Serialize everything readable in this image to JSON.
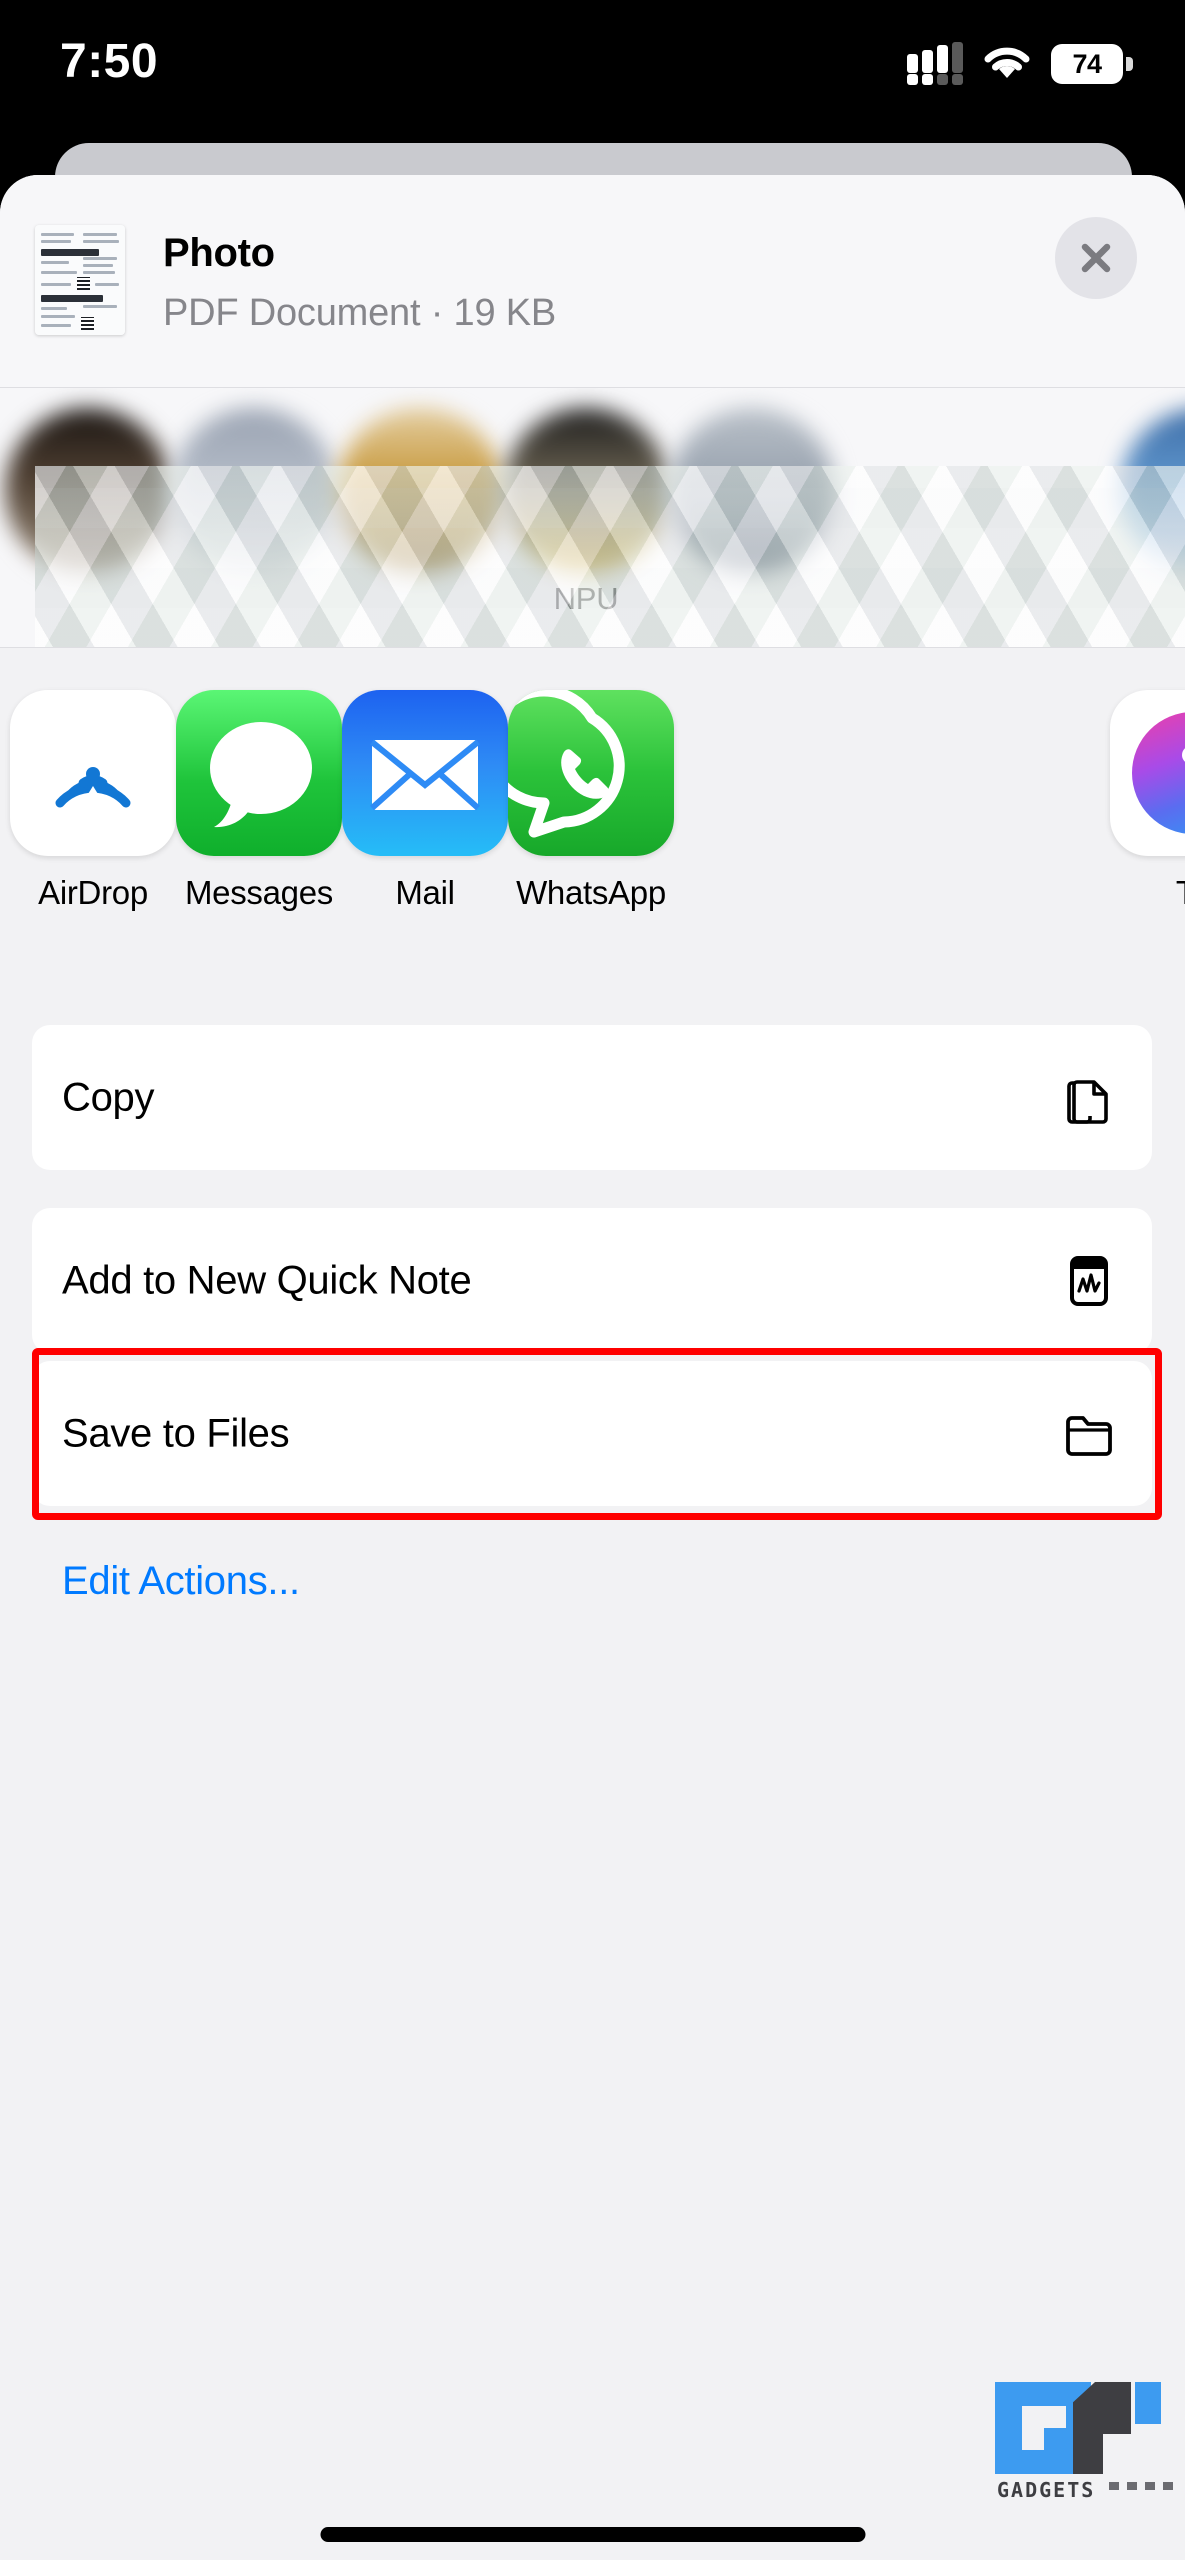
{
  "status_bar": {
    "time": "7:50",
    "signal_icon": "cellular-signal-icon",
    "wifi_icon": "wifi-icon",
    "battery_level": "74"
  },
  "share_sheet": {
    "document": {
      "title": "Photo",
      "subtitle": "PDF Document · 19 KB",
      "thumbnail_icon": "document-thumbnail"
    },
    "close_label": "Close",
    "close_icon": "close-icon",
    "contacts": [
      {
        "name": "",
        "avatar_color": "#3a2f28"
      },
      {
        "name": "",
        "avatar_color": "#9aa3b2"
      },
      {
        "name": "",
        "avatar_color": "#c9a24a"
      },
      {
        "name": "NPU",
        "avatar_color": "#2f2f2f"
      },
      {
        "name": "",
        "avatar_color": "#4a6fa5"
      }
    ],
    "apps": [
      {
        "label": "AirDrop",
        "icon": "airdrop-icon"
      },
      {
        "label": "Messages",
        "icon": "messages-icon"
      },
      {
        "label": "Mail",
        "icon": "mail-icon"
      },
      {
        "label": "WhatsApp",
        "icon": "whatsapp-icon"
      },
      {
        "label": "Te",
        "icon": "teams-icon"
      }
    ],
    "actions": [
      {
        "label": "Copy",
        "icon": "copy-icon",
        "highlighted": false
      },
      {
        "label": "Add to New Quick Note",
        "icon": "quick-note-icon",
        "highlighted": false
      },
      {
        "label": "Save to Files",
        "icon": "folder-icon",
        "highlighted": true
      }
    ],
    "edit_actions_label": "Edit Actions...",
    "highlight_color": "#FF0000",
    "link_color": "#007AFF"
  },
  "watermark": {
    "text": "GADGETS"
  }
}
